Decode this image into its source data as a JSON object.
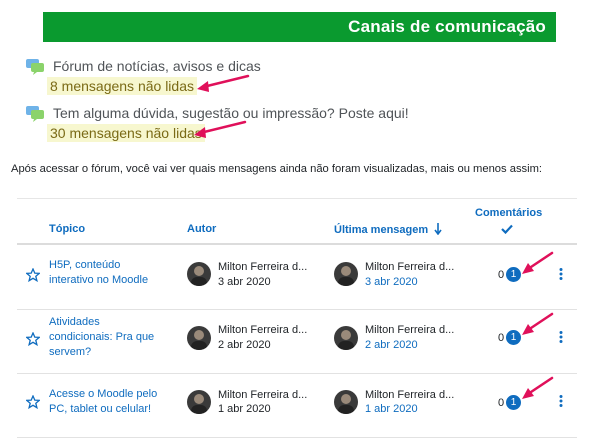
{
  "banner": {
    "title": "Canais de comunicação"
  },
  "forums": [
    {
      "title": "Fórum de notícias, avisos e dicas",
      "unread": "8 mensagens não lidas"
    },
    {
      "title": "Tem alguma dúvida, sugestão ou impressão? Poste aqui!",
      "unread": "30 mensagens não lidas"
    }
  ],
  "intro": "Após acessar o fórum, você vai ver quais mensagens ainda não foram visualizadas, mais ou menos assim:",
  "table": {
    "headers": {
      "topic": "Tópico",
      "author": "Autor",
      "last_post": "Última mensagem",
      "comments": "Comentários"
    },
    "rows": [
      {
        "topic_line1": "H5P, conteúdo",
        "topic_line2": "interativo no Moodle",
        "topic_line3": "",
        "author": "Milton Ferreira d...",
        "author_date": "3 abr 2020",
        "last_author": "Milton Ferreira d...",
        "last_date": "3 abr 2020",
        "count": "0",
        "unread": "1"
      },
      {
        "topic_line1": "Atividades",
        "topic_line2": "condicionais: Pra que",
        "topic_line3": "servem?",
        "author": "Milton Ferreira d...",
        "author_date": "2 abr 2020",
        "last_author": "Milton Ferreira d...",
        "last_date": "2 abr 2020",
        "count": "0",
        "unread": "1"
      },
      {
        "topic_line1": "Acesse o Moodle pelo",
        "topic_line2": "PC, tablet ou celular!",
        "topic_line3": "",
        "author": "Milton Ferreira d...",
        "author_date": "1 abr 2020",
        "last_author": "Milton Ferreira d...",
        "last_date": "1 abr 2020",
        "count": "0",
        "unread": "1"
      }
    ]
  },
  "colors": {
    "banner": "#0a9a2f",
    "link": "#0f6cbf",
    "unread_text": "#7a6a16",
    "unread_highlight": "#f7f7cf",
    "annotation_arrow": "#e0105a"
  },
  "icons": {
    "forum": "forum-chat-icon",
    "star": "star-outline-icon",
    "sort": "sort-arrow-down-icon",
    "check": "checkmark-icon",
    "menu": "vertical-ellipsis-icon",
    "annotation": "pink-arrow-annotation"
  }
}
